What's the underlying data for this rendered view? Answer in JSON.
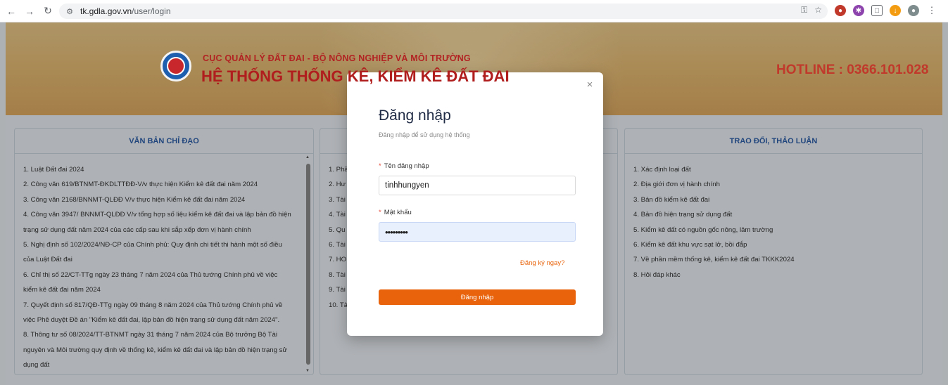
{
  "browser": {
    "url_domain": "tk.gdla.gov.vn",
    "url_path": "/user/login"
  },
  "header": {
    "org_name": "CỤC QUẢN LÝ ĐẤT ĐAI - BỘ NÔNG NGHIỆP VÀ MÔI TRƯỜNG",
    "system_title": "HỆ THỐNG THỐNG KÊ, KIỂM KÊ ĐẤT ĐAI",
    "hotline": "HOTLINE : 0366.101.028"
  },
  "panels": {
    "left": {
      "title": "VĂN BẢN CHỈ ĐẠO",
      "items": [
        "1. Luật Đất đai 2024",
        "2. Công văn 619/BTNMT-ĐKDLTTĐĐ-V/v thực hiện Kiểm kê đất đai năm 2024",
        "3. Công văn 2168/BNNMT-QLĐĐ V/v thực hiện Kiểm kê đất đai năm 2024",
        "4. Công văn 3947/ BNNMT-QLĐĐ V/v tổng hợp số liệu kiểm kê đất đai và lập bản đồ hiện",
        "trạng sử dụng đất năm 2024 của các cấp sau khi sắp xếp đơn vị hành chính",
        "5. Nghị định số 102/2024/NĐ-CP của Chính phủ: Quy định chi tiết thi hành một số điều",
        "của Luật Đất đai",
        "6. Chỉ thị số 22/CT-TTg ngày 23 tháng 7 năm 2024 của Thủ tướng Chính phủ về việc",
        "kiểm kê đất đai năm 2024",
        "7. Quyết định số 817/QĐ-TTg ngày 09 tháng 8 năm 2024 của Thủ tướng Chính phủ về",
        "việc Phê duyệt Đề án \"Kiểm kê đất đai, lập bản đồ hiện trạng sử dụng đất năm 2024\".",
        "8. Thông tư số 08/2024/TT-BTNMT ngày 31 tháng 7 năm 2024 của Bộ trưởng Bộ Tài",
        "nguyên và Môi trường quy định về thống kê, kiểm kê đất đai và lập bản đồ hiện trạng sử",
        "dụng đất"
      ]
    },
    "middle": {
      "items": [
        "1. Phầ",
        "2. Hư",
        "3. Tài",
        "4. Tài",
        "5. Qu",
        "6. Tài",
        "7. HO",
        "8. Tài",
        "9. Tài",
        "10. Tà"
      ]
    },
    "right": {
      "title": "TRAO ĐỔI, THẢO LUẬN",
      "items": [
        "1. Xác định loại đất",
        "2. Địa giới đơn vị hành chính",
        "3. Bản đồ kiểm kê đất đai",
        "4. Bản đồ hiện trạng sử dụng đất",
        "5. Kiểm kê đất có nguồn gốc nông, lâm trường",
        "6. Kiểm kê đất khu vực sạt lở, bồi đắp",
        "7. Về phần mềm thống kê, kiểm kê đất đai TKKK2024",
        "8. Hỏi đáp khác"
      ]
    }
  },
  "modal": {
    "close": "×",
    "title": "Đăng nhập",
    "subtitle": "Đăng nhập để sử dụng hệ thống",
    "username_label": "Tên đăng nhập",
    "username_value": "tinhhungyen",
    "password_label": "Mật khẩu",
    "password_value": "•••••••••",
    "required_mark": "*",
    "register_link": "Đăng ký ngay?",
    "submit_label": "Đăng nhập"
  }
}
